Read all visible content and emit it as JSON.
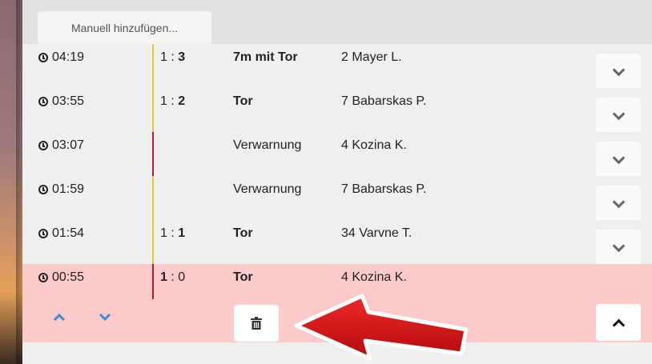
{
  "toolbar": {
    "add_label": "Manuell hinzufügen..."
  },
  "colors": {
    "goal_bar": "#e3c44a",
    "card_bar": "#a0203a",
    "highlight": "#fccaca",
    "nav_accent": "#3a8ed6",
    "arrow": "#d8141a"
  },
  "events": [
    {
      "time": "04:19",
      "score_home": "1",
      "score_away": "3",
      "bold_side": "away",
      "event": "7m mit Tor",
      "event_bold": true,
      "player": "2 Mayer L.",
      "bar": "goal"
    },
    {
      "time": "03:55",
      "score_home": "1",
      "score_away": "2",
      "bold_side": "away",
      "event": "Tor",
      "event_bold": true,
      "player": "7 Babarskas P.",
      "bar": "goal"
    },
    {
      "time": "03:07",
      "score_home": "",
      "score_away": "",
      "bold_side": "",
      "event": "Verwarnung",
      "event_bold": false,
      "player": "4 Kozina K.",
      "bar": "card"
    },
    {
      "time": "01:59",
      "score_home": "",
      "score_away": "",
      "bold_side": "",
      "event": "Verwarnung",
      "event_bold": false,
      "player": "7 Babarskas P.",
      "bar": "goal"
    },
    {
      "time": "01:54",
      "score_home": "1",
      "score_away": "1",
      "bold_side": "away",
      "event": "Tor",
      "event_bold": true,
      "player": "34 Varvne T.",
      "bar": "goal"
    },
    {
      "time": "00:55",
      "score_home": "1",
      "score_away": "0",
      "bold_side": "home",
      "event": "Tor",
      "event_bold": true,
      "player": "4 Kozina K.",
      "bar": "card",
      "selected": true
    }
  ],
  "icons": {
    "clock": "clock-icon",
    "expand": "chevron-down-icon",
    "collapse": "chevron-up-icon",
    "delete": "trash-icon",
    "move_up": "arrow-up-icon",
    "move_down": "arrow-down-icon"
  }
}
